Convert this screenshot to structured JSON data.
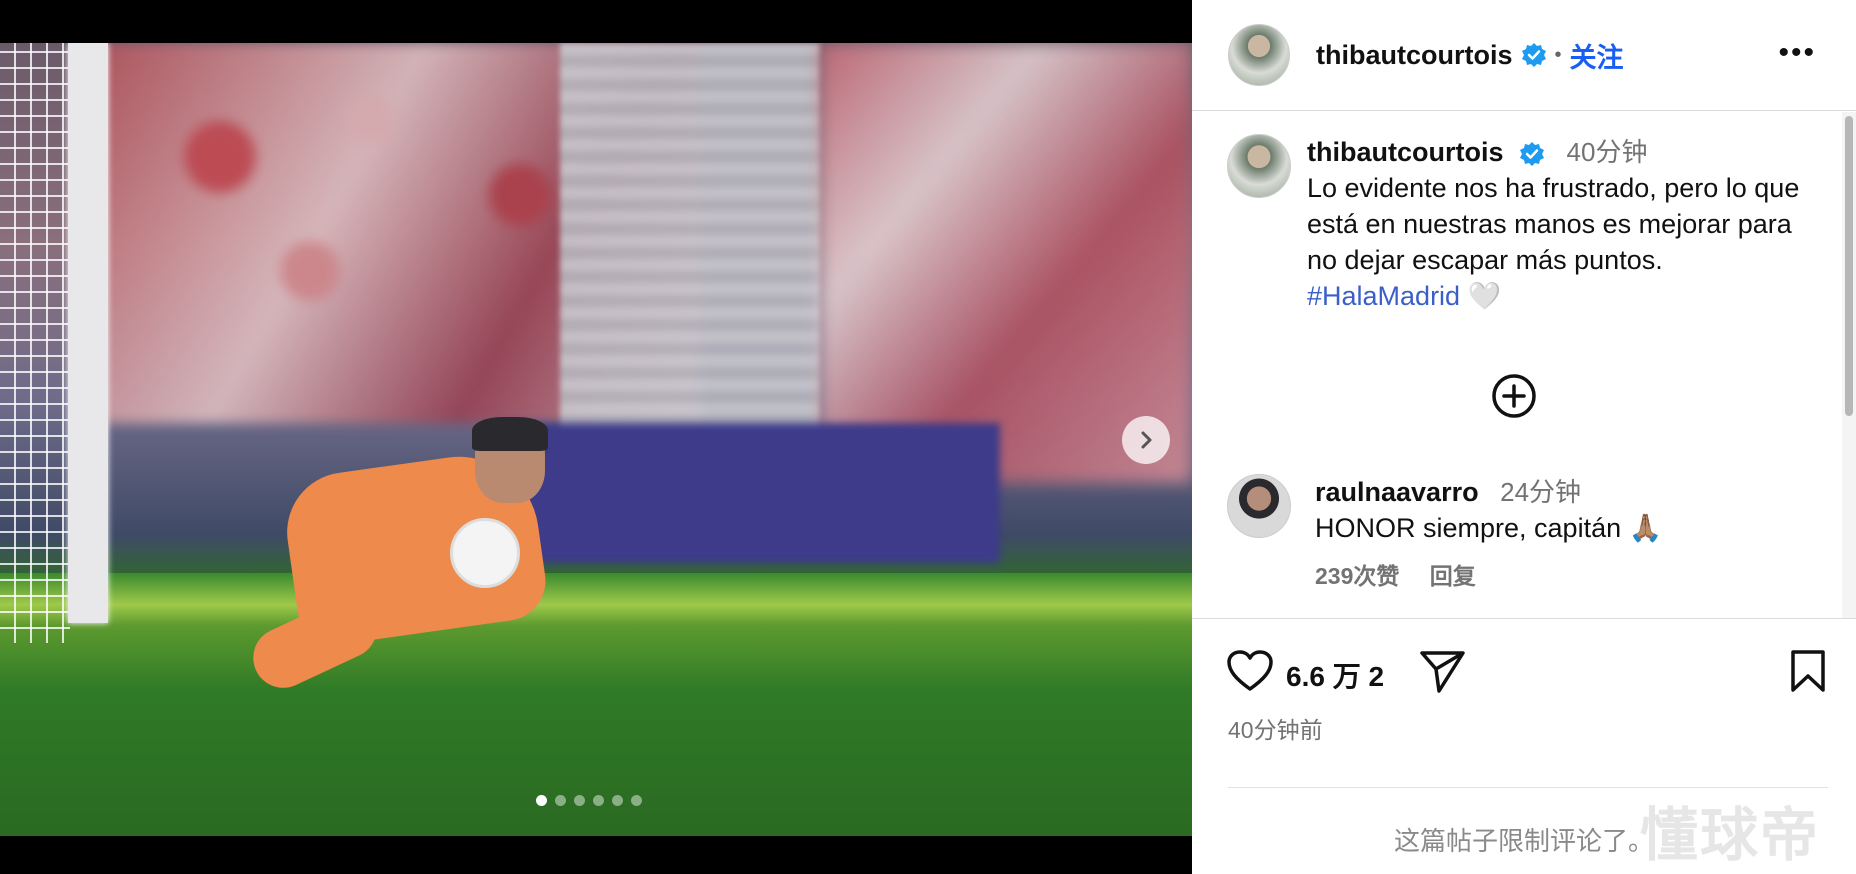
{
  "post": {
    "username": "thibautcourtois",
    "follow_label": "关注",
    "header_separator": "•",
    "more_label": "•••",
    "carousel": {
      "slide_count": 6,
      "active_index": 0
    }
  },
  "caption": {
    "username": "thibautcourtois",
    "time": "40分钟",
    "text_before_hashtag": "Lo evidente nos ha frustrado, pero lo que está en nuestras manos es mejorar para no dejar escapar más puntos.",
    "hashtag": "#HalaMadrid",
    "emoji": "🤍"
  },
  "comments": [
    {
      "username": "raulnaavarro",
      "time": "24分钟",
      "text": "HONOR siempre, capitán 🙏🏽",
      "likes": "239次赞",
      "reply_label": "回复"
    }
  ],
  "actions": {
    "like_count": "6.6 万 2",
    "post_time": "40分钟前",
    "comments_disabled": "这篇帖子限制评论了。"
  },
  "watermark": "懂球帝",
  "colors": {
    "link": "#3a5fc8",
    "follow": "#1a5df2",
    "verified": "#1d9bf0"
  }
}
